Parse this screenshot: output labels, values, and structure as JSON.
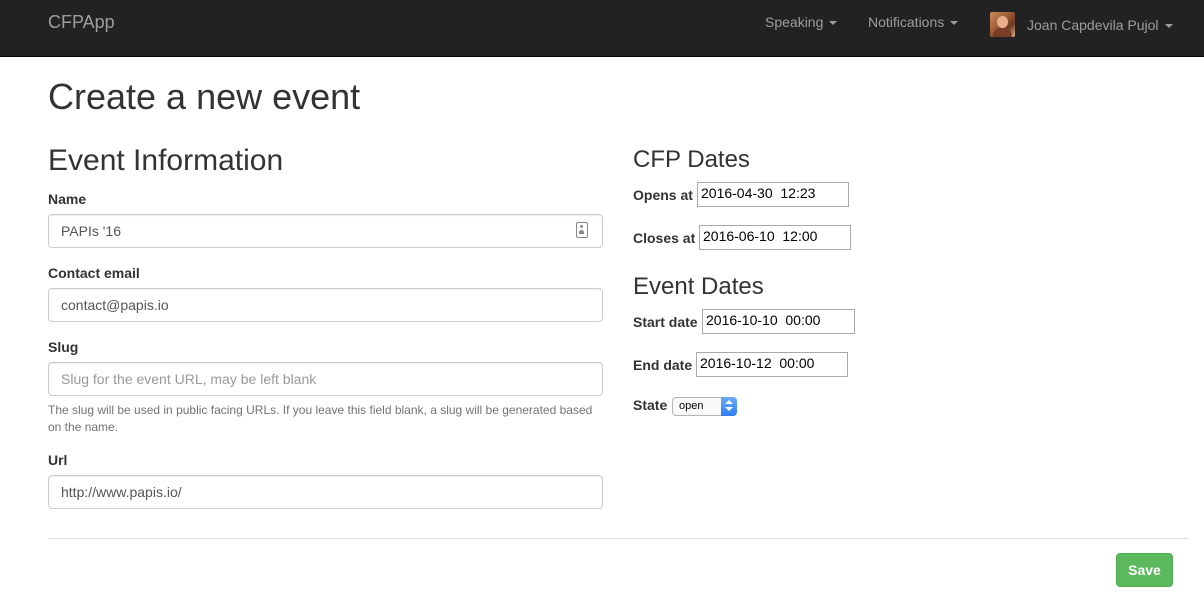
{
  "navbar": {
    "brand": "CFPApp",
    "speaking": "Speaking",
    "notifications": "Notifications",
    "user_name": "Joan Capdevila Pujol"
  },
  "page": {
    "title": "Create a new event"
  },
  "event_info": {
    "heading": "Event Information",
    "name_label": "Name",
    "name_value": "PAPIs '16",
    "email_label": "Contact email",
    "email_value": "contact@papis.io",
    "slug_label": "Slug",
    "slug_placeholder": "Slug for the event URL, may be left blank",
    "slug_value": "",
    "slug_help": "The slug will be used in public facing URLs. If you leave this field blank, a slug will be generated based on the name.",
    "url_label": "Url",
    "url_value": "http://www.papis.io/"
  },
  "cfp_dates": {
    "heading": "CFP Dates",
    "opens_label": "Opens at",
    "opens_value": "2016-04-30  12:23",
    "closes_label": "Closes at",
    "closes_value": "2016-06-10  12:00"
  },
  "event_dates": {
    "heading": "Event Dates",
    "start_label": "Start date",
    "start_value": "2016-10-10  00:00",
    "end_label": "End date",
    "end_value": "2016-10-12  00:00",
    "state_label": "State",
    "state_value": "open"
  },
  "actions": {
    "save_label": "Save"
  },
  "colors": {
    "navbar_bg": "#222222",
    "nav_text": "#9d9d9d",
    "save_bg": "#5cb85c",
    "select_accent": "#2f7ef0"
  }
}
